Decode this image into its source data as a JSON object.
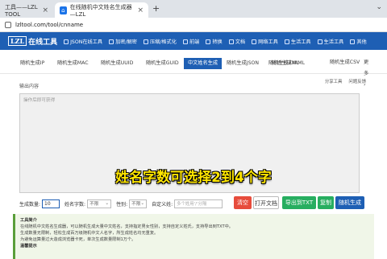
{
  "browser": {
    "tabs": [
      {
        "label": "工具——LZL TOOL"
      },
      {
        "label": "在线随机中文姓名生成器—LZL"
      }
    ],
    "new_tab": "+",
    "url": "lzltool.com/tool/cnname"
  },
  "site": {
    "logo_box": "LZL",
    "logo_text": "在线工具",
    "nav": [
      "JSON在线工具",
      "加密/解密",
      "压缩/格式化",
      "前端",
      "转换",
      "文档",
      "网络工具",
      "生活工具",
      "生活工具",
      "其他"
    ]
  },
  "subtabs": [
    "随机生成IP",
    "随机生成MAC",
    "随机生成UUID",
    "随机生成GUID",
    "中文姓名生成",
    "随机生成JSON",
    "随机生成XML",
    "随机生成YAML",
    "随机生成CSV",
    "更多 ›"
  ],
  "active_subtab": 4,
  "output": {
    "label": "输出内容",
    "placeholder": "操作后即可获得",
    "tools": [
      "分享工具",
      "问题反馈"
    ]
  },
  "caption": "姓名字数可选择2到4个字",
  "controls": {
    "count_label": "生成数量:",
    "count_value": "10",
    "name_len_label": "姓名字数:",
    "name_len_value": "不限",
    "gender_label": "性别:",
    "gender_value": "不限",
    "custom_label": "自定义姓:",
    "custom_placeholder": "多个姓用'/'分隔"
  },
  "buttons": {
    "clear": "清空",
    "open": "打开文档",
    "export": "导出到TXT",
    "copy": "复制",
    "generate": "随机生成"
  },
  "intro": {
    "title": "工具简介",
    "lines": [
      "在线随机中文姓名生成器，可以随机生成大量中文姓名，支持指定男女性别，支持自定义姓氏，支持导出到TXT中。",
      "生成数量无限制，轻松生成百万级随机中文人名字，所生成姓名均无重复。",
      "为避免运算量过大造成浏览器卡死，单次生成数量限制1万个。"
    ],
    "tip_title": "温馨提示"
  },
  "colors": {
    "nav": "#1e5fb4",
    "danger": "#e74c3c",
    "success": "#27ae60"
  }
}
